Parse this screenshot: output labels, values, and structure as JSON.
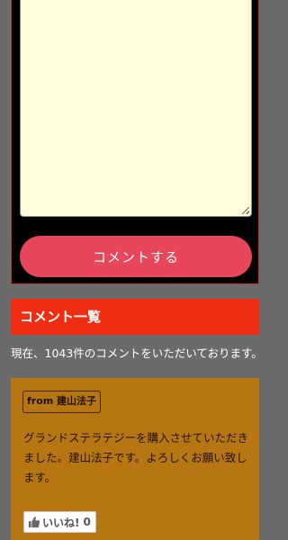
{
  "form": {
    "comment_value": "",
    "submit_label": "コメントする"
  },
  "comments_section": {
    "heading": "コメント一覧",
    "count_text": "現在、1043件のコメントをいただいております。"
  },
  "comments": [
    {
      "author": "from 建山法子",
      "body": "グランドステラテジーを購入させていただきました。建山法子です。よろしくお願い致します。",
      "like_label": "いいね!",
      "like_count": "0",
      "like_icon": "thumbs-up-icon"
    }
  ],
  "colors": {
    "page_background": "#6b6b6b",
    "form_panel": "#000000",
    "textarea_background": "#fffcdc",
    "submit_button": "#e8465a",
    "section_header": "#f02d12",
    "comment_card": "#b87613"
  }
}
